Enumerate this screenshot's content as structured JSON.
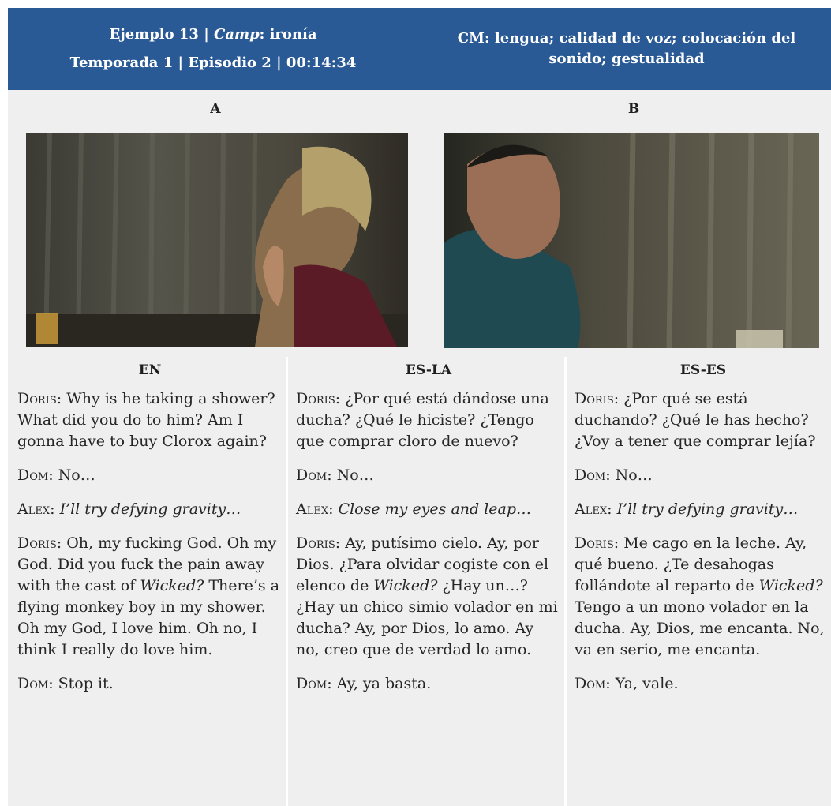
{
  "header": {
    "left_line1_prefix": "Ejemplo 13 | ",
    "left_line1_italic": "Camp",
    "left_line1_suffix": ": ironía",
    "left_line2": "Temporada 1 | Episodio 2 | 00:14:34",
    "right_line1": "CM: lengua; calidad de voz; colocación del",
    "right_line2": "sonido; gestualidad"
  },
  "frames": [
    {
      "label": "A"
    },
    {
      "label": "B"
    }
  ],
  "columns": [
    {
      "head": "EN",
      "lines": [
        {
          "speaker": "Doris",
          "parts": [
            {
              "t": "Why is he taking a shower? What did you do to him? Am I gonna have to buy Clorox again?"
            }
          ]
        },
        {
          "speaker": "Dom",
          "parts": [
            {
              "t": "No…"
            }
          ]
        },
        {
          "speaker": "Alex",
          "parts": [
            {
              "t": "I’ll try defying gravity…",
              "i": true
            }
          ]
        },
        {
          "speaker": "Doris",
          "parts": [
            {
              "t": "Oh, my fucking God. Oh my God. Did you fuck the pain away with the cast of "
            },
            {
              "t": "Wicked?",
              "i": true
            },
            {
              "t": " There’s a flying monkey boy in my shower. Oh my God, I love him. Oh no, I think I really do love him."
            }
          ]
        },
        {
          "speaker": "Dom",
          "parts": [
            {
              "t": "Stop it."
            }
          ]
        }
      ]
    },
    {
      "head": "ES-LA",
      "lines": [
        {
          "speaker": "Doris",
          "parts": [
            {
              "t": "¿Por qué está dándose una ducha? ¿Qué le hiciste? ¿Tengo que comprar cloro de nuevo?"
            }
          ]
        },
        {
          "speaker": "Dom",
          "parts": [
            {
              "t": "No…"
            }
          ]
        },
        {
          "speaker": "Alex",
          "parts": [
            {
              "t": "Close my eyes and leap…",
              "i": true
            }
          ]
        },
        {
          "speaker": "Doris",
          "parts": [
            {
              "t": "Ay, putísimo cielo. Ay, por Dios. ¿Para olvidar cogiste con el elenco de "
            },
            {
              "t": "Wicked?",
              "i": true
            },
            {
              "t": " ¿Hay un…? ¿Hay un chico simio volador en mi ducha? Ay, por Dios, lo amo. Ay no, creo que de verdad lo amo."
            }
          ]
        },
        {
          "speaker": "Dom",
          "parts": [
            {
              "t": "Ay, ya basta."
            }
          ]
        }
      ]
    },
    {
      "head": "ES-ES",
      "lines": [
        {
          "speaker": "Doris",
          "parts": [
            {
              "t": "¿Por qué se está duchando? ¿Qué le has hecho? ¿Voy a tener que comprar lejía?"
            }
          ]
        },
        {
          "speaker": "Dom",
          "parts": [
            {
              "t": "No…"
            }
          ]
        },
        {
          "speaker": "Alex",
          "parts": [
            {
              "t": "I’ll try defying gravity…",
              "i": true
            }
          ]
        },
        {
          "speaker": "Doris",
          "parts": [
            {
              "t": "Me cago en la leche. Ay, qué bueno. ¿Te desahogas follándote al reparto de "
            },
            {
              "t": "Wicked?",
              "i": true
            },
            {
              "t": " Tengo a un mono volador en la ducha. Ay, Dios, me encanta. No, va en serio, me encanta."
            }
          ]
        },
        {
          "speaker": "Dom",
          "parts": [
            {
              "t": "Ya, vale."
            }
          ]
        }
      ]
    }
  ]
}
